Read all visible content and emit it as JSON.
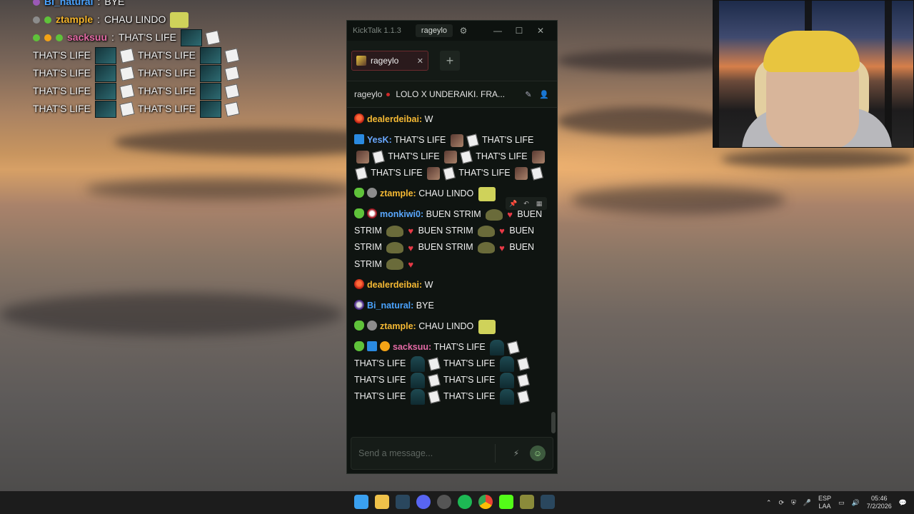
{
  "overlay_chat": [
    {
      "user": "Bi_natural",
      "text": "BYE",
      "user_color": "#4aa3ff"
    },
    {
      "user": "ztample",
      "text": "CHAU LINDO",
      "user_color": "#f3b32a"
    },
    {
      "user": "sacksuu",
      "text": "THAT'S LIFE",
      "user_color": "#e46aa5"
    },
    {
      "repeat_text": "THAT'S LIFE"
    }
  ],
  "window": {
    "title": "KickTalk 1.1.3",
    "user": "rageylo",
    "minimize": "—",
    "maximize": "☐",
    "close": "✕"
  },
  "tabs": {
    "items": [
      {
        "label": "rageylo",
        "close": "✕"
      }
    ],
    "add": "+"
  },
  "stream": {
    "channel": "rageylo",
    "title": "LOLO X UNDERAIKI. FRA..."
  },
  "messages": [
    {
      "user": "dealerdeibai:",
      "color": "#f5b934",
      "text": "W"
    },
    {
      "user": "YesK:",
      "color": "#6aa8ff",
      "text": "THAT'S LIFE",
      "repeat": "THAT'S LIFE"
    },
    {
      "user": "ztample:",
      "color": "#f5b934",
      "text": "CHAU LINDO"
    },
    {
      "user": "monkiwi0:",
      "color": "#5aa8ff",
      "text": "BUEN STRIM",
      "repeat": "BUEN",
      "repeat2": "STRIM",
      "repeat3": "BUEN STRIM"
    },
    {
      "user": "dealerdeibai:",
      "color": "#f5b934",
      "text": "W"
    },
    {
      "user": "Bi_natural:",
      "color": "#4aa3ff",
      "text": "BYE"
    },
    {
      "user": "ztample:",
      "color": "#f5b934",
      "text": "CHAU LINDO"
    },
    {
      "user": "sacksuu:",
      "color": "#e46aa5",
      "text": "THAT'S LIFE",
      "repeat": "THAT'S LIFE"
    }
  ],
  "input": {
    "placeholder": "Send a message..."
  },
  "taskbar": {
    "lang_top": "ESP",
    "lang_bottom": "LAA",
    "time": "05:46",
    "date": "7/2/2026"
  }
}
